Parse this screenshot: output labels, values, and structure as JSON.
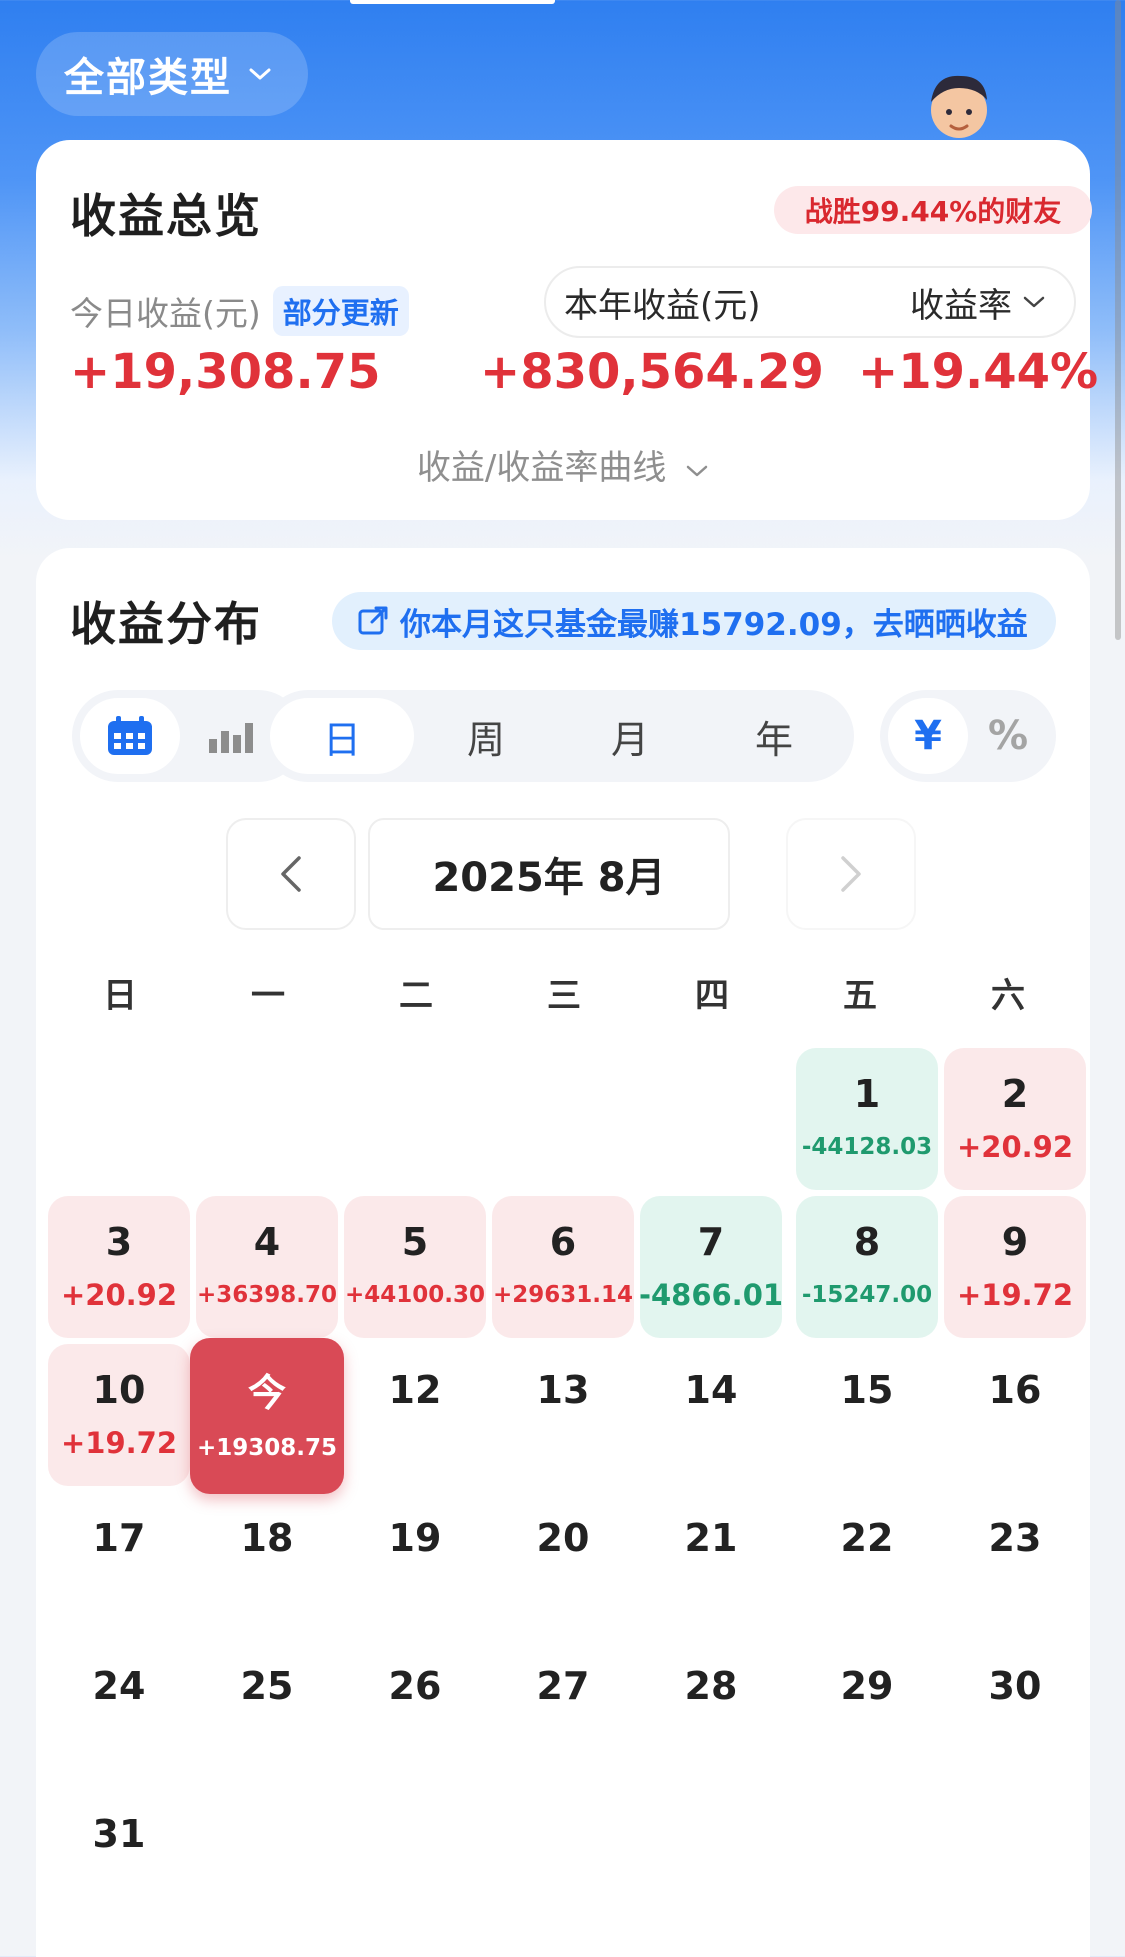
{
  "header": {
    "type_filter": "全部类型"
  },
  "overview": {
    "title": "收益总览",
    "beat_badge": "战胜99.44%的财友",
    "today_label": "今日收益(元)",
    "update_badge": "部分更新",
    "year_label": "本年收益(元)",
    "rate_label": "收益率",
    "today_value": "+19,308.75",
    "year_value": "+830,564.29",
    "rate_value": "+19.44%",
    "curve_toggle": "收益/收益率曲线"
  },
  "distribution": {
    "title": "收益分布",
    "promo_text": "你本月这只基金最赚15792.09，去晒晒收益",
    "view_modes": [
      "calendar-icon",
      "bar-chart-icon"
    ],
    "periods": [
      "日",
      "周",
      "月",
      "年"
    ],
    "active_period": "日",
    "units": [
      "¥",
      "%"
    ],
    "active_unit": "¥",
    "month_label": "2025年 8月",
    "weekdays": [
      "日",
      "一",
      "二",
      "三",
      "四",
      "五",
      "六"
    ],
    "days": [
      {
        "day": "1",
        "value": "-44128.03"
      },
      {
        "day": "2",
        "value": "+20.92"
      },
      {
        "day": "3",
        "value": "+20.92"
      },
      {
        "day": "4",
        "value": "+36398.70"
      },
      {
        "day": "5",
        "value": "+44100.30"
      },
      {
        "day": "6",
        "value": "+29631.14"
      },
      {
        "day": "7",
        "value": "-4866.01"
      },
      {
        "day": "8",
        "value": "-15247.00"
      },
      {
        "day": "9",
        "value": "+19.72"
      },
      {
        "day": "10",
        "value": "+19.72"
      },
      {
        "day": "今",
        "value": "+19308.75"
      },
      {
        "day": "12",
        "value": ""
      },
      {
        "day": "13",
        "value": ""
      },
      {
        "day": "14",
        "value": ""
      },
      {
        "day": "15",
        "value": ""
      },
      {
        "day": "16",
        "value": ""
      },
      {
        "day": "17",
        "value": ""
      },
      {
        "day": "18",
        "value": ""
      },
      {
        "day": "19",
        "value": ""
      },
      {
        "day": "20",
        "value": ""
      },
      {
        "day": "21",
        "value": ""
      },
      {
        "day": "22",
        "value": ""
      },
      {
        "day": "23",
        "value": ""
      },
      {
        "day": "24",
        "value": ""
      },
      {
        "day": "25",
        "value": ""
      },
      {
        "day": "26",
        "value": ""
      },
      {
        "day": "27",
        "value": ""
      },
      {
        "day": "28",
        "value": ""
      },
      {
        "day": "29",
        "value": ""
      },
      {
        "day": "30",
        "value": ""
      },
      {
        "day": "31",
        "value": ""
      }
    ]
  },
  "colors": {
    "gain": "#e0323a",
    "loss": "#1f9a6e",
    "accent": "#1f6ff0",
    "today": "#d94a56"
  }
}
